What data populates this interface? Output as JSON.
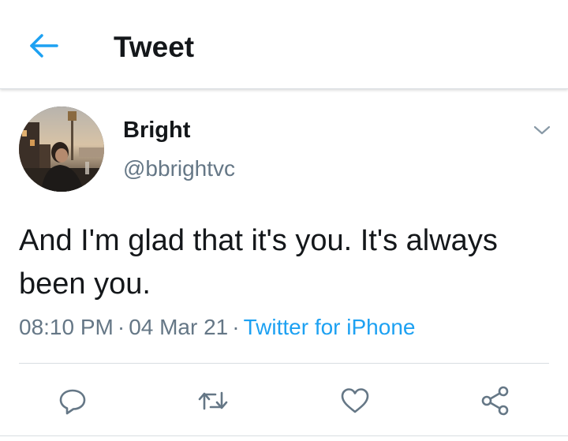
{
  "header": {
    "title": "Tweet",
    "back_icon": "arrow-left-icon"
  },
  "tweet": {
    "display_name": "Bright",
    "handle": "@bbrightvc",
    "text": "And I'm glad that it's you. It's always been you.",
    "time": "08:10 PM",
    "date": "04 Mar 21",
    "separator": "·",
    "source": "Twitter for iPhone",
    "menu_icon": "chevron-down-icon"
  },
  "actions": [
    {
      "name": "reply",
      "icon": "reply-icon"
    },
    {
      "name": "retweet",
      "icon": "retweet-icon"
    },
    {
      "name": "like",
      "icon": "heart-icon"
    },
    {
      "name": "share",
      "icon": "share-icon"
    }
  ],
  "colors": {
    "accent": "#1da1f2",
    "text": "#14171a",
    "secondary_text": "#657786",
    "divider": "#d8dde1"
  }
}
